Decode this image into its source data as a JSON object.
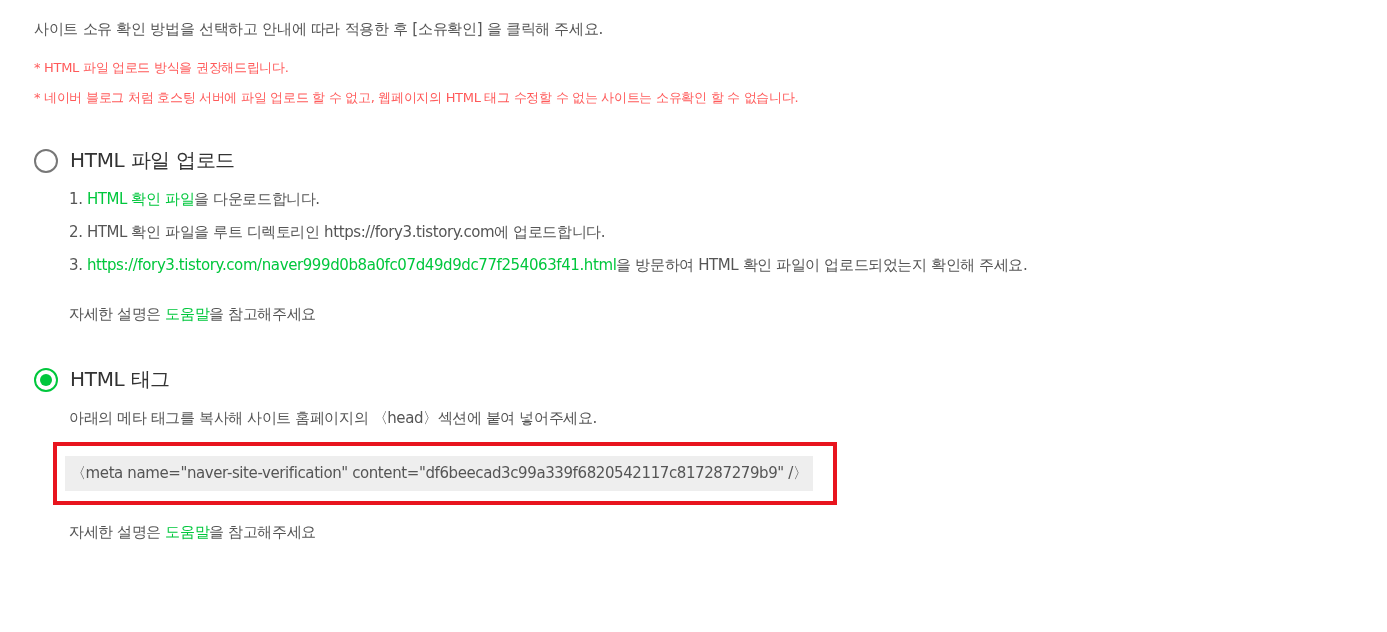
{
  "intro": "사이트 소유 확인 방법을 선택하고 안내에 따라 적용한 후  [소유확인] 을 클릭해 주세요.",
  "notices": [
    {
      "mark": "*",
      "text": "HTML 파일 업로드 방식을 권장해드립니다."
    },
    {
      "mark": "*",
      "text": "네이버 블로그 처럼 호스팅 서버에 파일 업로드 할 수 없고, 웹페이지의 HTML 태그 수정할 수 없는 사이트는 소유확인 할 수 없습니다."
    }
  ],
  "methods": [
    {
      "kind": "file",
      "label": "HTML 파일 업로드",
      "selected": false,
      "steps": [
        [
          {
            "kind": "text",
            "text": "1. "
          },
          {
            "kind": "link",
            "text": "HTML 확인 파일"
          },
          {
            "kind": "text",
            "text": "을 다운로드합니다."
          }
        ],
        [
          {
            "kind": "text",
            "text": "2. HTML 확인 파일을 루트 디렉토리인 https://fory3.tistory.com에 업로드합니다."
          }
        ],
        [
          {
            "kind": "text",
            "text": "3. "
          },
          {
            "kind": "link",
            "text": "https://fory3.tistory.com/naver999d0b8a0fc07d49d9dc77f254063f41.html"
          },
          {
            "kind": "text",
            "text": "을 방문하여 HTML 확인 파일이 업로드되었는지 확인해 주세요."
          }
        ]
      ],
      "help": [
        {
          "kind": "text",
          "text": "자세한 설명은 "
        },
        {
          "kind": "link",
          "text": "도움말"
        },
        {
          "kind": "text",
          "text": "을 참고해주세요"
        }
      ]
    },
    {
      "kind": "tag",
      "label": "HTML 태그",
      "selected": true,
      "description": "아래의 메타 태그를 복사해 사이트 홈페이지의 〈head〉섹션에 붙여 넣어주세요.",
      "meta_tag": {
        "text": "〈meta name=\"naver-site-verification\" content=\"df6beecad3c99a339f6820542117c817287279b9\" /〉",
        "highlighted": true
      },
      "help": [
        {
          "kind": "text",
          "text": "자세한 설명은 "
        },
        {
          "kind": "link",
          "text": "도움말"
        },
        {
          "kind": "text",
          "text": "을 참고해주세요"
        }
      ]
    }
  ]
}
